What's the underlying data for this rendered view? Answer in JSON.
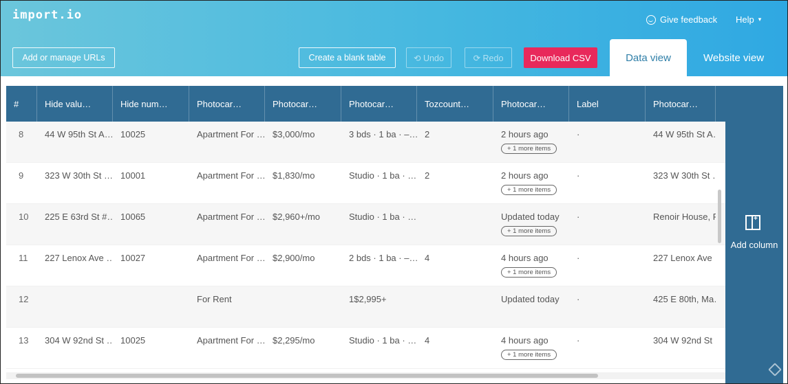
{
  "header": {
    "logo": "import.io",
    "feedback_label": "Give feedback",
    "help_label": "Help",
    "help_caret": "▾"
  },
  "toolbar": {
    "add_urls_label": "Add or manage URLs",
    "blank_table_label": "Create a blank table",
    "undo_label": "⟲ Undo",
    "redo_label": "⟳ Redo",
    "download_csv_label": "Download CSV"
  },
  "tabs": {
    "data_view": "Data view",
    "website_view": "Website view"
  },
  "table": {
    "columns": [
      "#",
      "Hide valu…",
      "Hide num…",
      "Photocar…",
      "Photocar…",
      "Photocar…",
      "Tozcount…",
      "Photocar…",
      "Label",
      "Photocar…"
    ],
    "rows": [
      {
        "num": "8",
        "c1": "44 W 95th St A…",
        "c2": "10025",
        "c3": "Apartment For …",
        "c4": "$3,000/mo",
        "c5": "3 bds · 1 ba · –…",
        "c6": "2",
        "c7": "2 hours ago",
        "more": "+ 1 more items",
        "c8": "·",
        "c9": "44 W 95th St A…"
      },
      {
        "num": "9",
        "c1": "323 W 30th St …",
        "c2": "10001",
        "c3": "Apartment For …",
        "c4": "$1,830/mo",
        "c5": "Studio · 1 ba · …",
        "c6": "2",
        "c7": "2 hours ago",
        "more": "+ 1 more items",
        "c8": "·",
        "c9": "323 W 30th St …"
      },
      {
        "num": "10",
        "c1": "225 E 63rd St #…",
        "c2": "10065",
        "c3": "Apartment For …",
        "c4": "$2,960+/mo",
        "c5": "Studio · 1 ba · …",
        "c6": "",
        "c7": "Updated today",
        "more": "+ 1 more items",
        "c8": "·",
        "c9": "Renoir House, R"
      },
      {
        "num": "11",
        "c1": "227 Lenox Ave …",
        "c2": "10027",
        "c3": "Apartment For …",
        "c4": "$2,900/mo",
        "c5": "2 bds · 1 ba · –…",
        "c6": "4",
        "c7": "4 hours ago",
        "more": "+ 1 more items",
        "c8": "·",
        "c9": "227 Lenox Ave …"
      },
      {
        "num": "12",
        "c1": "",
        "c2": "",
        "c3": "For Rent",
        "c4": "",
        "c5": "1$2,995+",
        "c6": "",
        "c7": "Updated today",
        "more": "",
        "c8": "·",
        "c9": "425 E 80th, Ma…"
      },
      {
        "num": "13",
        "c1": "304 W 92nd St …",
        "c2": "10025",
        "c3": "Apartment For …",
        "c4": "$2,295/mo",
        "c5": "Studio · 1 ba · …",
        "c6": "4",
        "c7": "4 hours ago",
        "more": "+ 1 more items",
        "c8": "·",
        "c9": "304 W 92nd St …"
      }
    ]
  },
  "add_column": {
    "label": "Add column"
  },
  "colors": {
    "header_gradient_start": "#6bc6dc",
    "header_gradient_end": "#2fa8e2",
    "table_header": "#306b93",
    "csv_button": "#e8295b"
  }
}
